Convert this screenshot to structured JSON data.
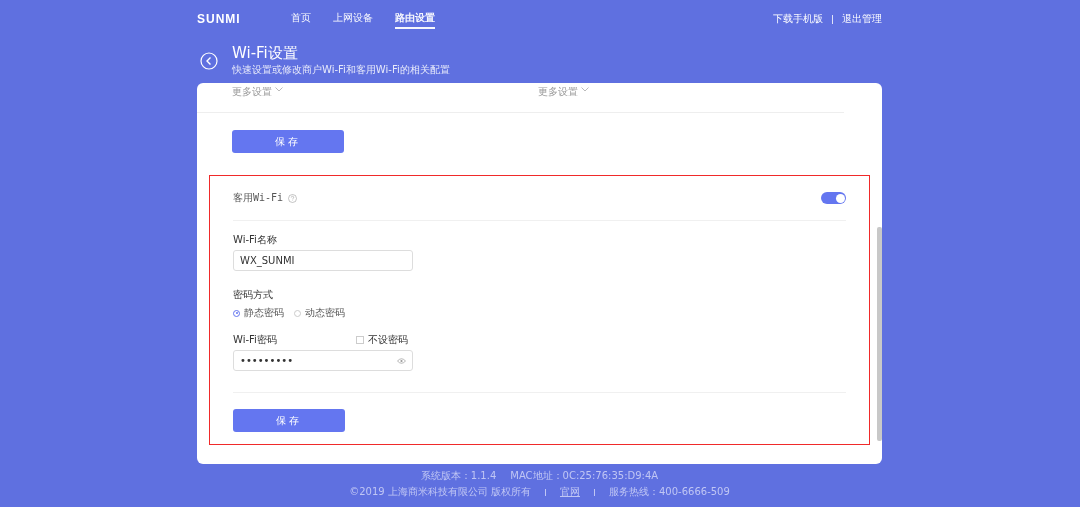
{
  "header": {
    "logo": "SUNMI",
    "nav": [
      {
        "label": "首页",
        "selected": false
      },
      {
        "label": "上网设备",
        "selected": false
      },
      {
        "label": "路由设置",
        "selected": true
      }
    ],
    "links": [
      "下载手机版",
      "退出管理"
    ]
  },
  "heading": {
    "title": "Wi-Fi设置",
    "subtitle": "快速设置或修改商户Wi-Fi和客用Wi-Fi的相关配置"
  },
  "card": {
    "more_settings": [
      "更多设置",
      "更多设置"
    ],
    "save": "保存",
    "guest_wifi": {
      "highlighted": true,
      "title": "客用Wi-Fi",
      "enabled": true,
      "name_label": "Wi-Fi名称",
      "name_value": "WX_SUNMI",
      "mode_label": "密码方式",
      "modes": [
        {
          "label": "静态密码",
          "selected": true
        },
        {
          "label": "动态密码",
          "selected": false
        }
      ],
      "password_label": "Wi-Fi密码",
      "no_password": {
        "label": "不设密码",
        "checked": false
      },
      "password_value": "•••••••••",
      "save": "保存"
    }
  },
  "footer": {
    "version": "系统版本：1.1.4",
    "mac": "MAC地址：0C:25:76:35:D9:4A",
    "copyright": "©2019 上海商米科技有限公司 版权所有",
    "site_link": "官网",
    "hotline": "服务热线：400-6666-509"
  }
}
